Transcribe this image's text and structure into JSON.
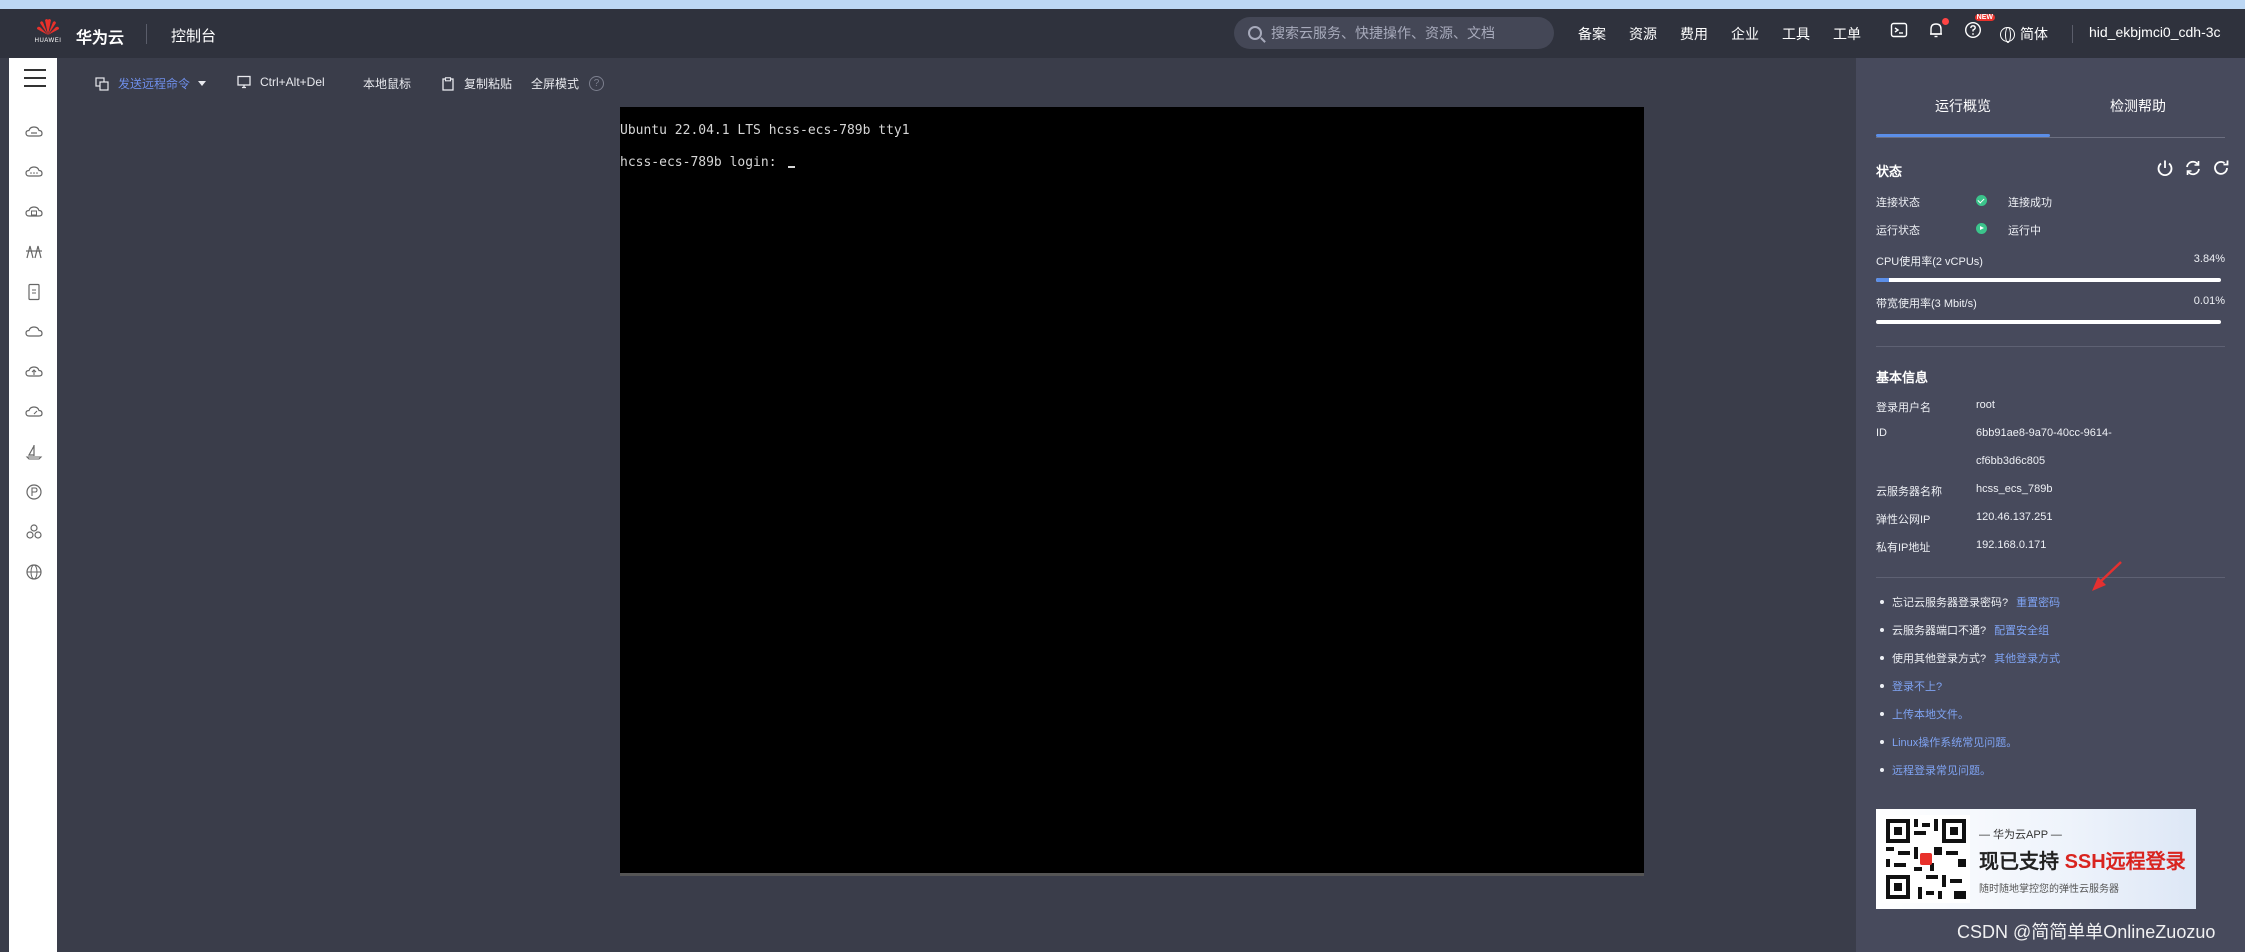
{
  "header": {
    "logo_text": "HUAWEI",
    "brand": "华为云",
    "console": "控制台",
    "search_placeholder": "搜索云服务、快捷操作、资源、文档",
    "nav": [
      "备案",
      "资源",
      "费用",
      "企业",
      "工具",
      "工单"
    ],
    "badge_new": "NEW",
    "language": "简体",
    "user": "hid_ekbjmci0_cdh-3c"
  },
  "sidebar": {
    "icons": [
      "cloud-server-icon",
      "cloud-chat-icon",
      "cloud-db-icon",
      "bridge-icon",
      "document-icon",
      "cloud-icon",
      "cloud-up-icon",
      "cloud-gauge-icon",
      "boat-icon",
      "parking-icon",
      "cluster-icon",
      "globe-icon"
    ]
  },
  "toolbar": {
    "send_command": "发送远程命令",
    "ctrl_alt_del": "Ctrl+Alt+Del",
    "local_mouse": "本地鼠标",
    "copy_paste": "复制粘贴",
    "fullscreen": "全屏模式",
    "help": "?"
  },
  "terminal": {
    "line1": "Ubuntu 22.04.1 LTS hcss-ecs-789b tty1",
    "line2": "hcss-ecs-789b login: "
  },
  "panel": {
    "tabs": [
      "运行概览",
      "检测帮助"
    ],
    "status": {
      "title": "状态",
      "connection_label": "连接状态",
      "connection_value": "连接成功",
      "run_label": "运行状态",
      "run_value": "运行中",
      "cpu_label": "CPU使用率(2 vCPUs)",
      "cpu_value": "3.84%",
      "cpu_fraction": 0.0384,
      "bw_label": "带宽使用率(3 Mbit/s)",
      "bw_value": "0.01%",
      "bw_fraction": 0.0001
    },
    "basic": {
      "title": "基本信息",
      "rows": [
        {
          "k": "登录用户名",
          "v": "root"
        },
        {
          "k": "ID",
          "v": "6bb91ae8-9a70-40cc-9614-"
        },
        {
          "k": "",
          "v": "cf6bb3d6c805"
        },
        {
          "k": "云服务器名称",
          "v": "hcss_ecs_789b"
        },
        {
          "k": "弹性公网IP",
          "v": "120.46.137.251"
        },
        {
          "k": "私有IP地址",
          "v": "192.168.0.171"
        }
      ]
    },
    "tips": [
      {
        "text": "忘记云服务器登录密码?",
        "link": "重置密码"
      },
      {
        "text": "云服务器端口不通?",
        "link": "配置安全组"
      },
      {
        "text": "使用其他登录方式?",
        "link": "其他登录方式"
      },
      {
        "text": "",
        "link": "登录不上?"
      },
      {
        "text": "",
        "link": "上传本地文件。"
      },
      {
        "text": "",
        "link": "Linux操作系统常见问题。"
      },
      {
        "text": "",
        "link": "远程登录常见问题。"
      }
    ],
    "banner": {
      "small": "— 华为云APP —",
      "big_prefix": "现已支持 ",
      "big_highlight": "SSH远程登录",
      "tiny": "随时随地掌控您的弹性云服务器"
    }
  },
  "watermark": "CSDN @简简单单OnlineZuozuo",
  "colors": {
    "accent": "#5b8ee8",
    "link": "#7fa3f2",
    "ok": "#3bc48b",
    "panel_bg": "#474a5c",
    "header_bg": "#2f323d"
  }
}
